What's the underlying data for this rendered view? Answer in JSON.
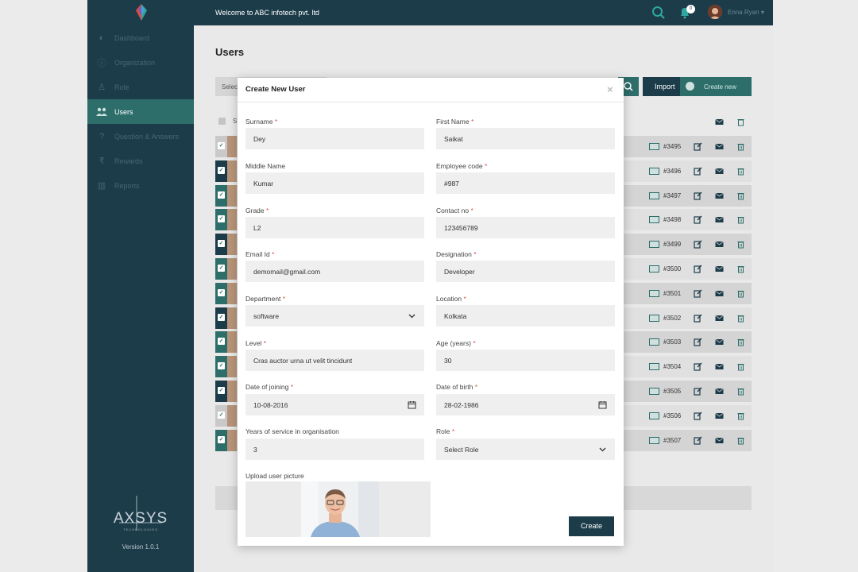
{
  "topbar": {
    "welcome": "Welcome to ABC infotech pvt. ltd",
    "notification_count": "0",
    "username": "Enna Ryan"
  },
  "sidebar": {
    "items": [
      {
        "label": "Dashboard"
      },
      {
        "label": "Organization"
      },
      {
        "label": "Role"
      },
      {
        "label": "Users"
      },
      {
        "label": "Question & Answers"
      },
      {
        "label": "Rewards"
      },
      {
        "label": "Reports"
      }
    ],
    "brand": "AXSYS",
    "brand_sub": "TECHNOLOGIES",
    "version": "Version 1.0.1"
  },
  "page": {
    "title": "Users"
  },
  "toolbar": {
    "select_label": "Select",
    "import_label": "Import",
    "create_label": "Create new"
  },
  "table": {
    "header_label": "S",
    "rows": [
      {
        "id": "#3495"
      },
      {
        "id": "#3496"
      },
      {
        "id": "#3497"
      },
      {
        "id": "#3498"
      },
      {
        "id": "#3499"
      },
      {
        "id": "#3500"
      },
      {
        "id": "#3501"
      },
      {
        "id": "#3502"
      },
      {
        "id": "#3503"
      },
      {
        "id": "#3504"
      },
      {
        "id": "#3505"
      },
      {
        "id": "#3506"
      },
      {
        "id": "#3507"
      }
    ]
  },
  "modal": {
    "title": "Create New User",
    "close": "×",
    "fields": {
      "surname": {
        "label": "Surname",
        "value": "Dey"
      },
      "first_name": {
        "label": "First Name",
        "value": "Saikat"
      },
      "middle_name": {
        "label": "Middle Name",
        "value": "Kumar"
      },
      "employee_code": {
        "label": "Employee code",
        "value": "#987"
      },
      "grade": {
        "label": "Grade",
        "value": "L2"
      },
      "contact_no": {
        "label": "Contact no",
        "value": "123456789"
      },
      "email": {
        "label": "Email Id",
        "value": "demomail@gmail.com"
      },
      "designation": {
        "label": "Designation",
        "value": "Developer"
      },
      "department": {
        "label": "Department",
        "value": "software"
      },
      "location": {
        "label": "Location",
        "value": "Kolkata"
      },
      "level": {
        "label": "Level",
        "value": "Cras auctor urna ut velit tincidunt"
      },
      "age": {
        "label": "Age (years)",
        "value": "30"
      },
      "date_of_joining": {
        "label": "Date of joining",
        "value": "10-08-2016"
      },
      "date_of_birth": {
        "label": "Date of birth",
        "value": "28-02-1986"
      },
      "years_of_service": {
        "label": "Years of service in organisation",
        "value": "3"
      },
      "role": {
        "label": "Role",
        "value": "Select Role"
      }
    },
    "upload_label": "Upload user picture",
    "create_label": "Create",
    "required_mark": "*"
  },
  "colors": {
    "dark": "#1d3c4a",
    "teal": "#2d6e6a",
    "required": "#d9534f"
  }
}
